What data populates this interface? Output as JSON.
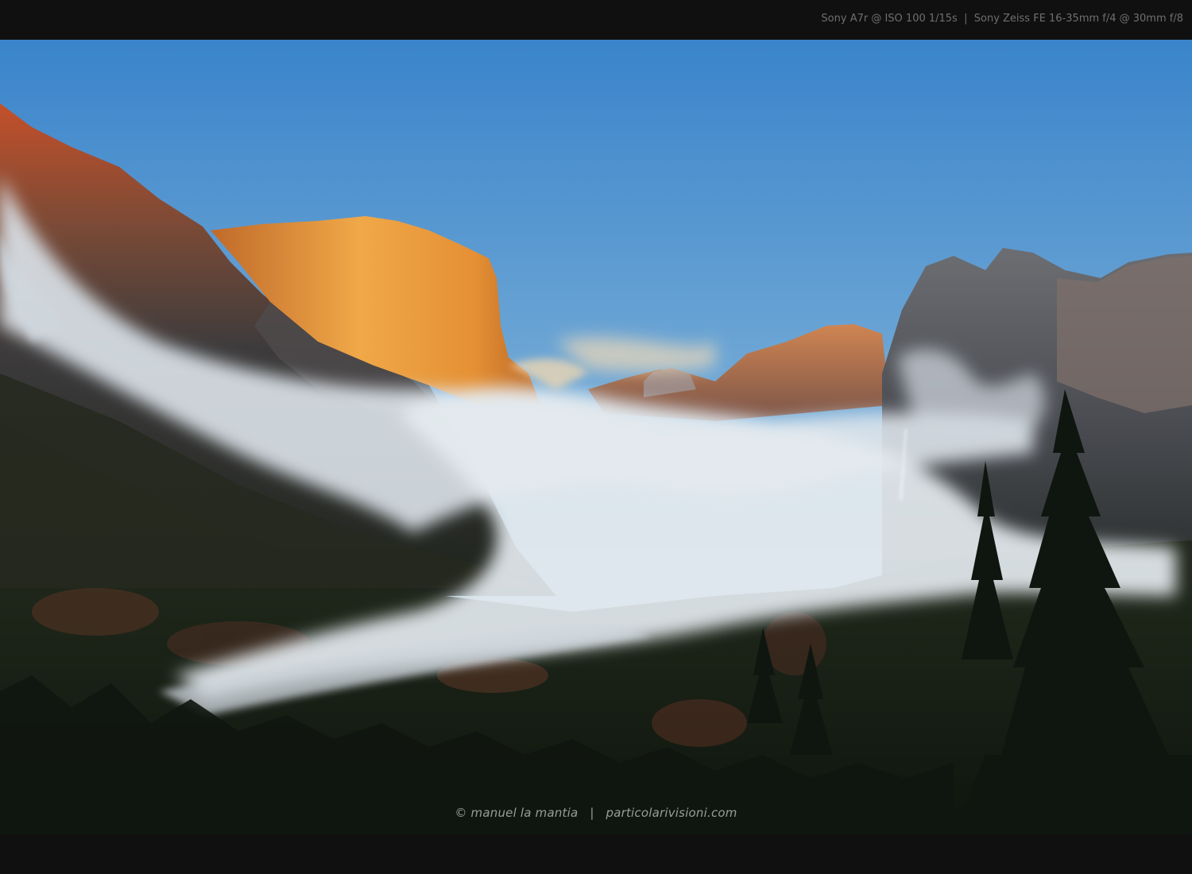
{
  "header": {
    "camera_info": "Sony A7r @ ISO 100 1/15s",
    "separator": "|",
    "lens_info": "Sony Zeiss FE 16-35mm f/4 @ 30mm f/8"
  },
  "photo": {
    "subject": "Yosemite Valley at sunset with fog, El Capitan and Bridalveil Fall",
    "colors": {
      "sky_top": "#3f88cc",
      "sky_bottom": "#b8d2de",
      "rock_lit": "#e89a3c",
      "rock_shadow": "#5a5e66",
      "forest": "#1a2416",
      "fog": "#d9e1e8"
    }
  },
  "watermark": {
    "copyright": "© manuel la mantia",
    "separator": "|",
    "website": "particolarivisioni.com"
  }
}
